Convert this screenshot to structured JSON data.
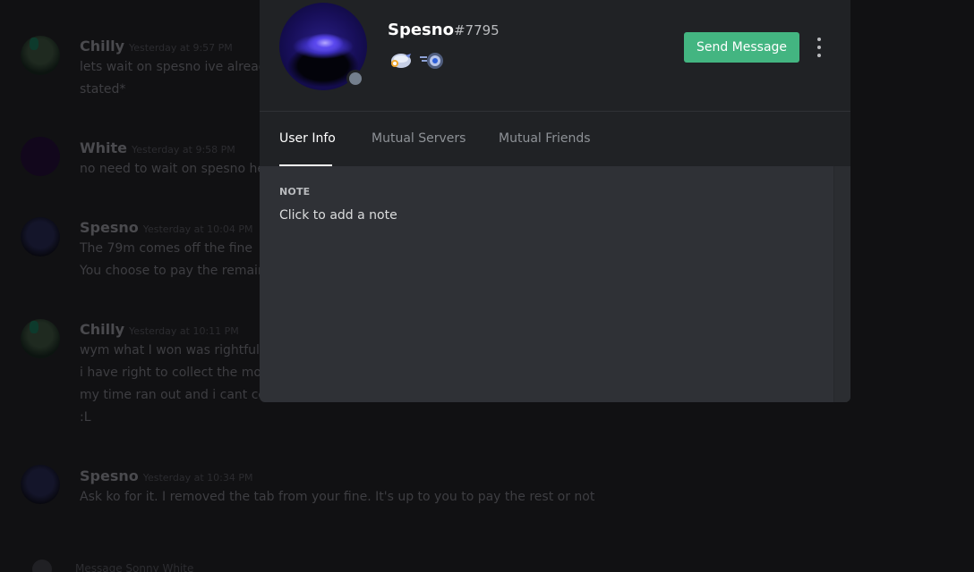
{
  "profile": {
    "username": "Spesno",
    "discriminator": "#7795",
    "status_color": "#747f8d",
    "badges": [
      "hypesquad-badge-icon",
      "nitro-boost-badge-icon"
    ],
    "send_message_label": "Send Message",
    "more_icon": "vertical-ellipsis-icon",
    "accent_color": "#43b581"
  },
  "tabs": [
    {
      "label": "User Info",
      "active": true
    },
    {
      "label": "Mutual Servers",
      "active": false
    },
    {
      "label": "Mutual Friends",
      "active": false
    }
  ],
  "note": {
    "label": "NOTE",
    "placeholder": "Click to add a note"
  },
  "chat": {
    "messages": [
      {
        "author": "Chilly",
        "timestamp": "Yesterday at 9:57 PM",
        "lines": [
          "lets wait on spesno ive already",
          "stated*"
        ]
      },
      {
        "author": "White",
        "timestamp": "Yesterday at 9:58 PM",
        "lines": [
          "no need to wait on spesno hes"
        ]
      },
      {
        "author": "Spesno",
        "timestamp": "Yesterday at 10:04 PM",
        "lines": [
          "The 79m comes off the fine",
          "You choose to pay the remain"
        ]
      },
      {
        "author": "Chilly",
        "timestamp": "Yesterday at 10:11 PM",
        "lines": [
          "wym what I won was rightfully",
          "i have right to collect the mon",
          "my time ran out and i cant cov",
          ":L"
        ]
      },
      {
        "author": "Spesno",
        "timestamp": "Yesterday at 10:34 PM",
        "lines": [
          "Ask ko for it. I removed the tab from your fine. It's up to you to pay the rest or not"
        ]
      }
    ],
    "input_placeholder": "Message Sonny White"
  }
}
